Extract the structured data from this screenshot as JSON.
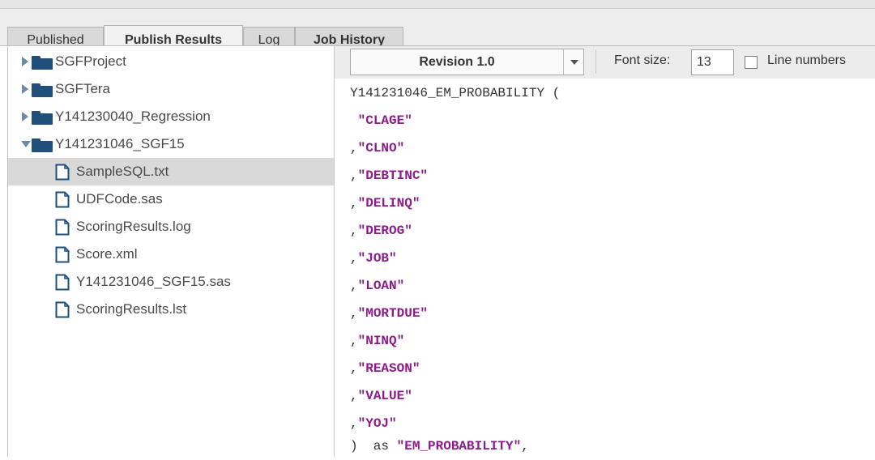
{
  "tabs": [
    {
      "label": "Published"
    },
    {
      "label": "Publish Results"
    },
    {
      "label": "Log"
    },
    {
      "label": "Job History"
    }
  ],
  "tree": {
    "items": [
      {
        "label": "SGFProject",
        "icon": "folder-icon",
        "expanded": false
      },
      {
        "label": "SGFTera",
        "icon": "folder-icon",
        "expanded": false
      },
      {
        "label": "Y141230040_Regression",
        "icon": "folder-icon",
        "expanded": false
      },
      {
        "label": "Y141231046_SGF15",
        "icon": "folder-icon",
        "expanded": true
      },
      {
        "label": "SampleSQL.txt",
        "icon": "file-icon",
        "selected": true
      },
      {
        "label": "UDFCode.sas",
        "icon": "file-icon"
      },
      {
        "label": "ScoringResults.log",
        "icon": "file-icon"
      },
      {
        "label": "Score.xml",
        "icon": "file-icon"
      },
      {
        "label": "Y141231046_SGF15.sas",
        "icon": "file-icon"
      },
      {
        "label": "ScoringResults.lst",
        "icon": "file-icon"
      }
    ]
  },
  "toolbar": {
    "revision": "Revision 1.0",
    "font_size_label": "Font size:",
    "font_size_value": "13",
    "line_numbers_label": "Line numbers",
    "line_numbers_checked": false
  },
  "code": {
    "header": "Y141231046_EM_PROBABILITY (",
    "lines": [
      {
        "prefix": " ",
        "value": "\"CLAGE\""
      },
      {
        "prefix": ",",
        "value": "\"CLNO\""
      },
      {
        "prefix": ",",
        "value": "\"DEBTINC\""
      },
      {
        "prefix": ",",
        "value": "\"DELINQ\""
      },
      {
        "prefix": ",",
        "value": "\"DEROG\""
      },
      {
        "prefix": ",",
        "value": "\"JOB\""
      },
      {
        "prefix": ",",
        "value": "\"LOAN\""
      },
      {
        "prefix": ",",
        "value": "\"MORTDUE\""
      },
      {
        "prefix": ",",
        "value": "\"NINQ\""
      },
      {
        "prefix": ",",
        "value": "\"REASON\""
      },
      {
        "prefix": ",",
        "value": "\"VALUE\""
      },
      {
        "prefix": ",",
        "value": "\"YOJ\""
      }
    ],
    "footer_prefix": ")  as ",
    "footer_value": "\"EM_PROBABILITY\"",
    "footer_suffix": ","
  },
  "colors": {
    "string": "#8b1a8b",
    "folder": "#1f4f7a",
    "selection": "#d9d9d9"
  }
}
